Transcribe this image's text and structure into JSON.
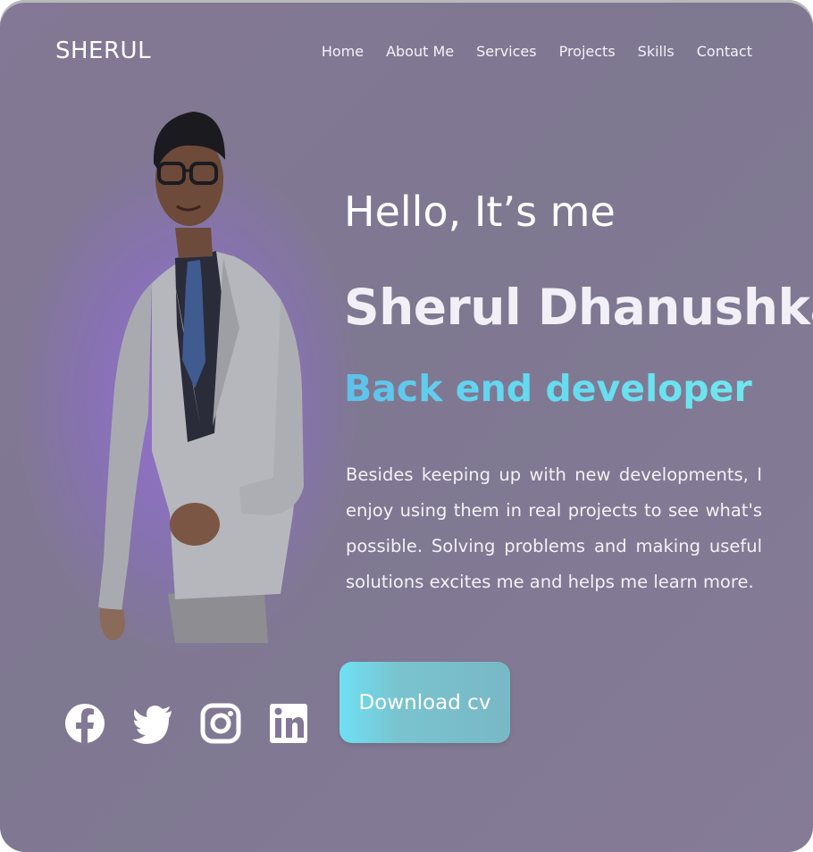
{
  "header": {
    "logo": "SHERUL",
    "nav": [
      "Home",
      "About Me",
      "Services",
      "Projects",
      "Skills",
      "Contact"
    ]
  },
  "hero": {
    "greeting": "Hello, It’s me",
    "name": "Sherul Dhanushka",
    "role": "Back end developer",
    "description": "Besides keeping up with new developments, I enjoy using them in real projects to see what's possible. Solving problems and making useful solutions excites me and helps me learn more.",
    "cta": "Download cv"
  },
  "socials": [
    {
      "icon": "facebook-icon"
    },
    {
      "icon": "twitter-icon"
    },
    {
      "icon": "instagram-icon"
    },
    {
      "icon": "linkedin-icon"
    }
  ],
  "colors": {
    "background": "#837895",
    "accent": "#63d9f0",
    "glow": "#9670d2"
  }
}
